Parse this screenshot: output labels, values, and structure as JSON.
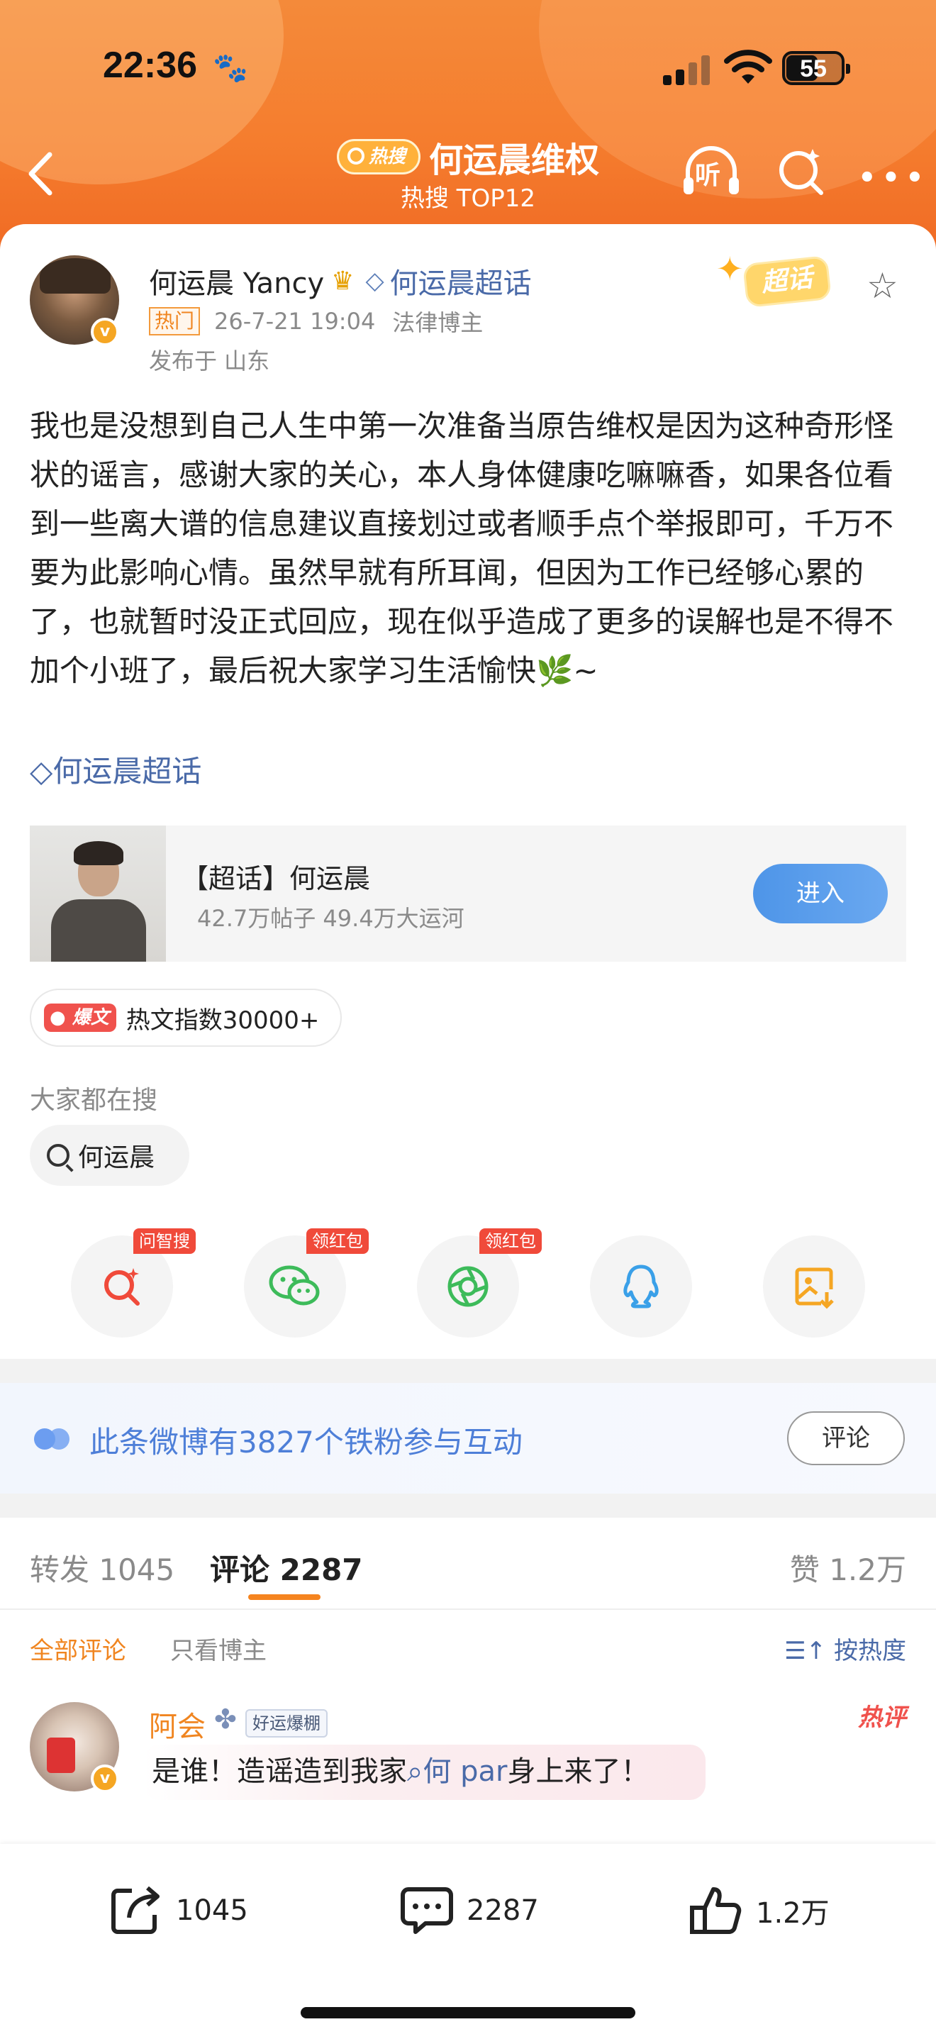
{
  "status_bar": {
    "time": "22:36",
    "battery": "55"
  },
  "nav": {
    "hot_pill": "热搜",
    "title": "何运晨维权",
    "subtitle": "热搜 TOP12",
    "listen_label": "听"
  },
  "post": {
    "author": "何运晨 Yancy",
    "topic_link": "何运晨超话",
    "hot_tag": "热门",
    "timestamp": "26-7-21 19:04",
    "role": "法律博主",
    "location": "发布于 山东",
    "chaohua_badge": "超话",
    "content": "我也是没想到自己人生中第一次准备当原告维权是因为这种奇形怪状的谣言，感谢大家的关心，本人身体健康吃嘛嘛香，如果各位看到一些离大谱的信息建议直接划过或者顺手点个举报即可，千万不要为此影响心情。虽然早就有所耳闻，但因为工作已经够心累的了，也就暂时没正式回应，现在似乎造成了更多的误解也是不得不加个小班了，最后祝大家学习生活愉快",
    "content_tail": "~",
    "topic_line": "何运晨超话"
  },
  "super_card": {
    "name": "【超话】何运晨",
    "stats": "42.7万帖子 49.4万大运河",
    "enter": "进入"
  },
  "hot_article": {
    "badge": "爆文",
    "text": "热文指数30000+"
  },
  "search": {
    "label": "大家都在搜",
    "chip": "何运晨"
  },
  "share_targets": [
    {
      "icon": "wenzhisou-icon",
      "tag": "问智搜",
      "color": "#f04a3a"
    },
    {
      "icon": "wechat-icon",
      "tag": "领红包",
      "color": "#3dbb5a"
    },
    {
      "icon": "moments-icon",
      "tag": "领红包",
      "color": "#3dbb5a"
    },
    {
      "icon": "qq-icon",
      "tag": "",
      "color": "#3aa0e8"
    },
    {
      "icon": "save-image-icon",
      "tag": "",
      "color": "#f5a623"
    }
  ],
  "fans": {
    "text": "此条微博有3827个铁粉参与互动",
    "button": "评论"
  },
  "tabs": {
    "repost": "转发 1045",
    "comment": "评论 2287",
    "like": "赞 1.2万"
  },
  "filter": {
    "all": "全部评论",
    "owner": "只看博主",
    "sort": "按热度"
  },
  "comment": {
    "name": "阿会",
    "badge": "好运爆棚",
    "hot": "热评",
    "text_before": "是谁！造谣造到我家",
    "link": "何 par",
    "text_after": "身上来了！"
  },
  "bottom": {
    "repost": "1045",
    "comment": "2287",
    "like": "1.2万"
  },
  "colors": {
    "accent": "#f08520",
    "link": "#4a6aa8",
    "header": "#f57d2e"
  }
}
